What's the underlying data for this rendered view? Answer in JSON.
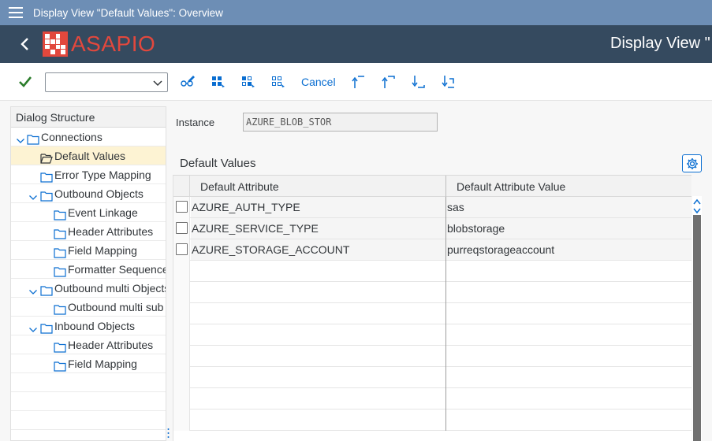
{
  "titlebar": {
    "title": "Display View \"Default Values\": Overview"
  },
  "shell": {
    "logo_text": "ASAPIO",
    "title": "Display View \""
  },
  "toolbar": {
    "select_value": "",
    "cancel_label": "Cancel"
  },
  "dialog": {
    "header": "Dialog Structure",
    "items": [
      {
        "label": "Connections"
      },
      {
        "label": "Default Values"
      },
      {
        "label": "Error Type Mapping"
      },
      {
        "label": "Outbound  Objects"
      },
      {
        "label": "Event Linkage"
      },
      {
        "label": "Header Attributes"
      },
      {
        "label": "Field Mapping"
      },
      {
        "label": "Formatter Sequence"
      },
      {
        "label": "Outbound multi Objects"
      },
      {
        "label": "Outbound multi sub O"
      },
      {
        "label": "Inbound Objects"
      },
      {
        "label": "Header Attributes"
      },
      {
        "label": "Field Mapping"
      }
    ]
  },
  "instance": {
    "label": "Instance",
    "value": "AZURE_BLOB_STOR"
  },
  "section": {
    "title": "Default Values"
  },
  "table": {
    "columns": [
      "Default Attribute",
      "Default Attribute Value"
    ],
    "rows": [
      {
        "attribute": "AZURE_AUTH_TYPE",
        "value": "sas"
      },
      {
        "attribute": "AZURE_SERVICE_TYPE",
        "value": "blobstorage"
      },
      {
        "attribute": "AZURE_STORAGE_ACCOUNT",
        "value": "purreqstorageaccount"
      }
    ]
  },
  "colors": {
    "titlebar": "#6d8eb5",
    "shell": "#354a5f",
    "brand": "#e2483d",
    "accent": "#0a6ed1",
    "selected_row": "#fdf3d3"
  }
}
